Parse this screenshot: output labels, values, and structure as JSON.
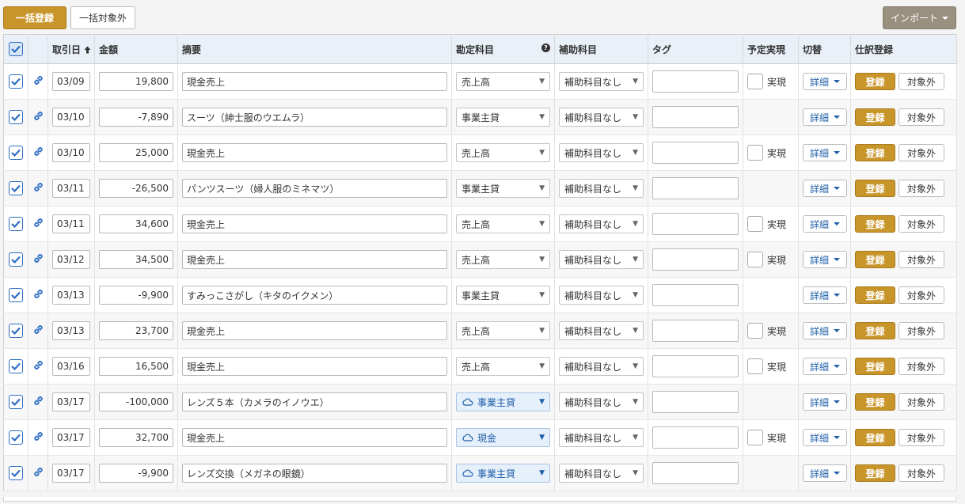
{
  "toolbar": {
    "bulk_register": "一括登録",
    "bulk_exclude": "一括対象外",
    "import": "インポート"
  },
  "headers": {
    "date": "取引日",
    "amount": "金額",
    "description": "摘要",
    "account": "勘定科目",
    "sub_account": "補助科目",
    "tag": "タグ",
    "planned": "予定実現",
    "switch": "切替",
    "journal": "仕訳登録"
  },
  "labels": {
    "realized": "実現",
    "detail": "詳細",
    "register": "登録",
    "exclude": "対象外"
  },
  "colors": {
    "accent_gold": "#c8952a",
    "link_blue": "#2d6ec4",
    "header_bg": "#eaf0f8",
    "import_bg": "#9a9080"
  },
  "rows": [
    {
      "date": "03/09",
      "amount": "19,800",
      "description": "現金売上",
      "account": "売上高",
      "account_suggested": false,
      "sub_account": "補助科目なし",
      "tag": "",
      "planned": true
    },
    {
      "date": "03/10",
      "amount": "-7,890",
      "description": "スーツ（紳士服のウエムラ）",
      "account": "事業主貸",
      "account_suggested": false,
      "sub_account": "補助科目なし",
      "tag": "",
      "planned": false
    },
    {
      "date": "03/10",
      "amount": "25,000",
      "description": "現金売上",
      "account": "売上高",
      "account_suggested": false,
      "sub_account": "補助科目なし",
      "tag": "",
      "planned": true
    },
    {
      "date": "03/11",
      "amount": "-26,500",
      "description": "パンツスーツ（婦人服のミネマツ）",
      "account": "事業主貸",
      "account_suggested": false,
      "sub_account": "補助科目なし",
      "tag": "",
      "planned": false
    },
    {
      "date": "03/11",
      "amount": "34,600",
      "description": "現金売上",
      "account": "売上高",
      "account_suggested": false,
      "sub_account": "補助科目なし",
      "tag": "",
      "planned": true
    },
    {
      "date": "03/12",
      "amount": "34,500",
      "description": "現金売上",
      "account": "売上高",
      "account_suggested": false,
      "sub_account": "補助科目なし",
      "tag": "",
      "planned": true
    },
    {
      "date": "03/13",
      "amount": "-9,900",
      "description": "すみっこさがし（キタのイクメン）",
      "account": "事業主貸",
      "account_suggested": false,
      "sub_account": "補助科目なし",
      "tag": "",
      "planned": false
    },
    {
      "date": "03/13",
      "amount": "23,700",
      "description": "現金売上",
      "account": "売上高",
      "account_suggested": false,
      "sub_account": "補助科目なし",
      "tag": "",
      "planned": true
    },
    {
      "date": "03/16",
      "amount": "16,500",
      "description": "現金売上",
      "account": "売上高",
      "account_suggested": false,
      "sub_account": "補助科目なし",
      "tag": "",
      "planned": true
    },
    {
      "date": "03/17",
      "amount": "-100,000",
      "description": "レンズ５本（カメラのイノウエ）",
      "account": "事業主貸",
      "account_suggested": true,
      "sub_account": "補助科目なし",
      "tag": "",
      "planned": false
    },
    {
      "date": "03/17",
      "amount": "32,700",
      "description": "現金売上",
      "account": "現金",
      "account_suggested": true,
      "sub_account": "補助科目なし",
      "tag": "",
      "planned": true
    },
    {
      "date": "03/17",
      "amount": "-9,900",
      "description": "レンズ交換（メガネの眼鏡）",
      "account": "事業主貸",
      "account_suggested": true,
      "sub_account": "補助科目なし",
      "tag": "",
      "planned": false
    }
  ]
}
